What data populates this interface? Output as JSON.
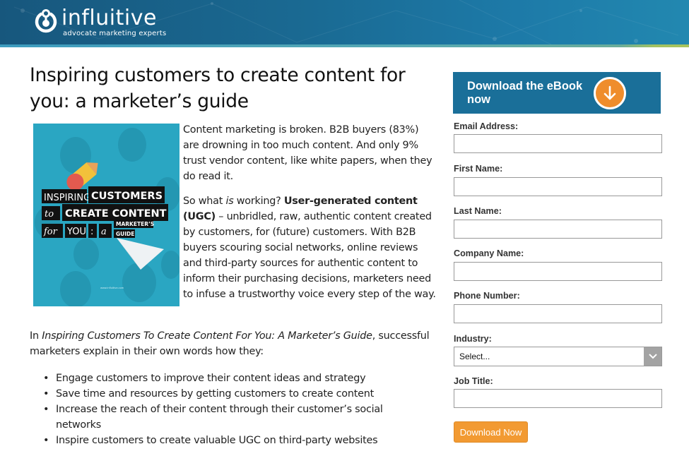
{
  "header": {
    "brand": "influitive",
    "tagline": "advocate marketing experts",
    "logo_icon": "power-logo-icon",
    "colors": {
      "bg": "#17577d",
      "stripe_blue": "#57a9b2",
      "stripe_green": "#a9c45c"
    }
  },
  "main": {
    "title": "Inspiring customers to create content for you: a marketer’s guide",
    "cover": {
      "line1_light": "INSPIRING",
      "line1_bold": "CUSTOMERS",
      "line2_script": "to",
      "line2_bold": "CREATE CONTENT",
      "line3_script": "for",
      "line3_light": "YOU",
      "line3_colon": ":",
      "line3_a": "a",
      "line3_tag1": "MARKETER’S",
      "line3_tag2": "GUIDE",
      "url": "www.influitive.com"
    },
    "para1": "Content marketing is broken. B2B buyers (83%) are drowning in too much content. And only 9% trust vendor content, like white papers, when they do read it.",
    "para2": {
      "lead": "So what ",
      "italic": "is",
      "mid": " working? ",
      "bold": "User-generated content (UGC)",
      "rest": " – unbridled, raw, authentic content created by customers, for (future) customers. With B2B buyers scouring social networks, online reviews and third-party sources for authentic content to inform their purchasing decisions, marketers need to infuse a trustworthy voice every step of the way."
    },
    "para3": {
      "lead": "In ",
      "italic": "Inspiring Customers To Create Content For You: A Marketer’s Guide",
      "rest": ", successful marketers explain in their own words how they:"
    },
    "bullets": [
      "Engage customers to improve their content ideas and strategy",
      "Save time and resources by getting customers to create content",
      "Increase the reach of their content through their customer’s social networks",
      "Inspire customers to create valuable UGC on third-party websites"
    ],
    "bullet_char": "•"
  },
  "form": {
    "cta_text": "Download the eBook now",
    "cta_icon": "arrow-down-circle-icon",
    "fields": [
      {
        "label": "Email Address:",
        "value": ""
      },
      {
        "label": "First Name:",
        "value": ""
      },
      {
        "label": "Last Name:",
        "value": ""
      },
      {
        "label": "Company Name:",
        "value": ""
      },
      {
        "label": "Phone Number:",
        "value": ""
      }
    ],
    "industry": {
      "label": "Industry:",
      "selected": "Select..."
    },
    "job_title": {
      "label": "Job Title:",
      "value": ""
    },
    "submit_label": "Download Now",
    "colors": {
      "cta_bg": "#1a6f99",
      "accent_orange": "#f29a32"
    }
  }
}
